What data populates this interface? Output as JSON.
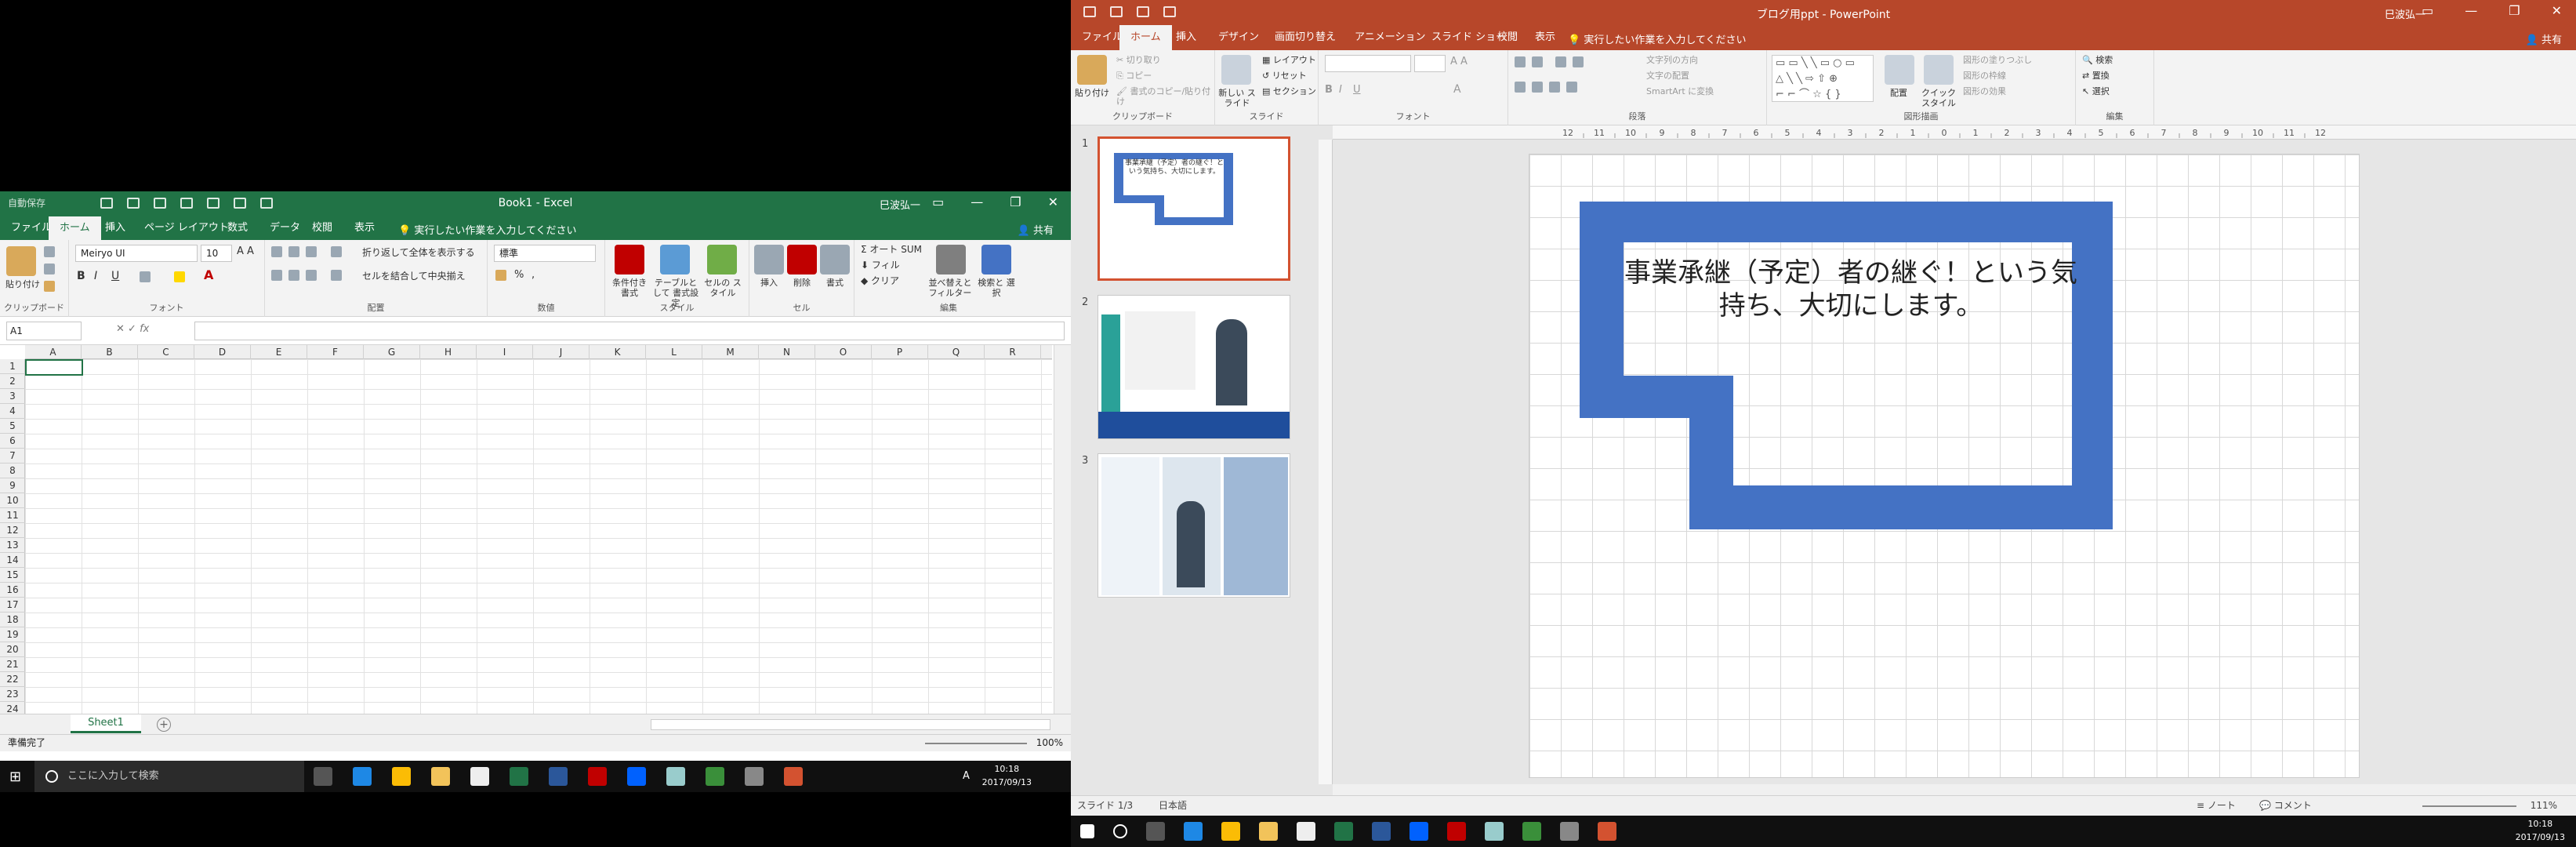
{
  "excel": {
    "autosave": "自動保存",
    "title": "Book1 - Excel",
    "user": "巳波弘一",
    "tabs": [
      "ファイル",
      "ホーム",
      "挿入",
      "ページ レイアウト",
      "数式",
      "データ",
      "校閲",
      "表示"
    ],
    "tell_me": "実行したい作業を入力してください",
    "share": "共有",
    "ribbon": {
      "paste": "貼り付け",
      "clipboard": "クリップボード",
      "font_name": "Meiryo UI",
      "font_size": "10",
      "font_group": "フォント",
      "wrap_text": "折り返して全体を表示する",
      "merge_center": "セルを結合して中央揃え",
      "alignment_group": "配置",
      "number_format": "標準",
      "number_group": "数値",
      "conditional": "条件付き 書式",
      "table_format": "テーブルとして 書式設定",
      "cell_style": "セルの スタイル",
      "style_group": "スタイル",
      "insert": "挿入",
      "delete": "削除",
      "format": "書式",
      "cells_group": "セル",
      "autosum": "オート SUM",
      "fill": "フィル",
      "clear": "クリア",
      "sort_filter": "並べ替えと フィルター",
      "find_select": "検索と 選択",
      "editing_group": "編集"
    },
    "name_box": "A1",
    "fx": "fx",
    "columns": [
      "A",
      "B",
      "C",
      "D",
      "E",
      "F",
      "G",
      "H",
      "I",
      "J",
      "K",
      "L",
      "M",
      "N",
      "O",
      "P",
      "Q",
      "R"
    ],
    "rows": [
      "1",
      "2",
      "3",
      "4",
      "5",
      "6",
      "7",
      "8",
      "9",
      "10",
      "11",
      "12",
      "13",
      "14",
      "15",
      "16",
      "17",
      "18",
      "19",
      "20",
      "21",
      "22",
      "23",
      "24"
    ],
    "sheet": "Sheet1",
    "add_sheet": "+",
    "status": "準備完了",
    "zoom": "100%"
  },
  "taskbar_left": {
    "search_placeholder": "ここに入力して検索",
    "time": "10:18",
    "date": "2017/09/13",
    "ime": "A"
  },
  "powerpoint": {
    "title": "ブログ用ppt - PowerPoint",
    "user": "巳波弘一",
    "tabs": [
      "ファイル",
      "ホーム",
      "挿入",
      "デザイン",
      "画面切り替え",
      "アニメーション",
      "スライド ショー",
      "校閲",
      "表示"
    ],
    "tell_me": "実行したい作業を入力してください",
    "share": "共有",
    "ribbon": {
      "paste": "貼り付け",
      "cut": "切り取り",
      "copy": "コピー",
      "format_painter": "書式のコピー/貼り付け",
      "clipboard": "クリップボード",
      "new_slide": "新しい スライド",
      "layout": "レイアウト",
      "reset": "リセット",
      "section": "セクション",
      "slides_group": "スライド",
      "font_group": "フォント",
      "text_direction": "文字列の方向",
      "align_text": "文字の配置",
      "smartart": "SmartArt に変換",
      "paragraph_group": "段落",
      "arrange": "配置",
      "quick_style": "クイック スタイル",
      "shape_fill": "図形の塗りつぶし",
      "shape_outline": "図形の枠線",
      "shape_effects": "図形の効果",
      "drawing_group": "図形描画",
      "find": "検索",
      "replace": "置換",
      "select": "選択",
      "editing_group": "編集"
    },
    "ruler_labels": [
      "12",
      "11",
      "10",
      "9",
      "8",
      "7",
      "6",
      "5",
      "4",
      "3",
      "2",
      "1",
      "0",
      "1",
      "2",
      "3",
      "4",
      "5",
      "6",
      "7",
      "8",
      "9",
      "10",
      "11",
      "12"
    ],
    "thumbnails": [
      {
        "num": "1",
        "caption": "事業承継（予定）者の継ぐ！という気持ち、大切にします。"
      },
      {
        "num": "2",
        "caption": ""
      },
      {
        "num": "3",
        "caption": ""
      }
    ],
    "slide_text": "事業承継（予定）者の継ぐ！という気持ち、大切にします。",
    "frame_color": "#4472c4",
    "status": {
      "slide": "スライド 1/3",
      "language": "日本語",
      "notes": "ノート",
      "comments": "コメント",
      "zoom": "111%"
    }
  },
  "taskbar_right": {
    "time": "10:18",
    "date": "2017/09/13"
  },
  "colors": {
    "excel_green": "#217346",
    "ppt_orange": "#b7472a",
    "slide_blue": "#4472c4"
  }
}
